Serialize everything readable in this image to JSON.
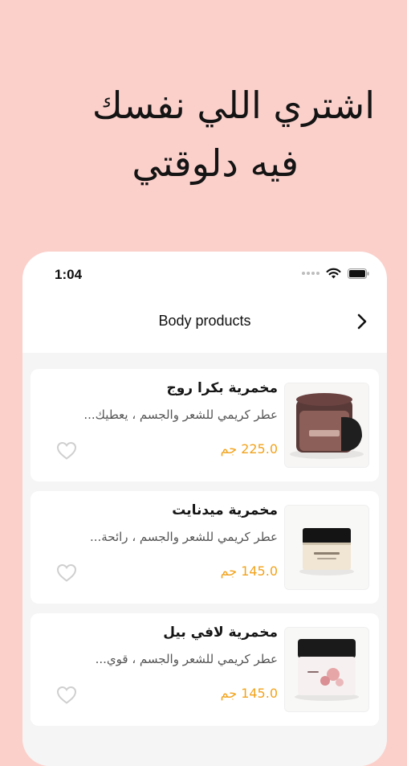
{
  "headline": {
    "line1": "اشتري اللي نفسك",
    "line2": "فيه دلوقتي"
  },
  "status_bar": {
    "time": "1:04"
  },
  "navbar": {
    "title": "Body products"
  },
  "products": [
    {
      "name": "مخمرية بكرا روج",
      "description": "عطر كريمي للشعر والجسم ، يعطيك...",
      "price": "225.0 جم"
    },
    {
      "name": "مخمرية ميدنايت",
      "description": "عطر كريمي للشعر والجسم ، رائحة...",
      "price": "145.0 جم"
    },
    {
      "name": "مخمرية لافي بيل",
      "description": "عطر كريمي للشعر والجسم ، قوي...",
      "price": "145.0 جم"
    }
  ],
  "icons": {
    "favorite": "heart-outline-icon",
    "forward": "chevron-right-icon"
  },
  "colors": {
    "background": "#fbd0cb",
    "price": "#f2a31c",
    "list_bg": "#f5f5f5"
  }
}
